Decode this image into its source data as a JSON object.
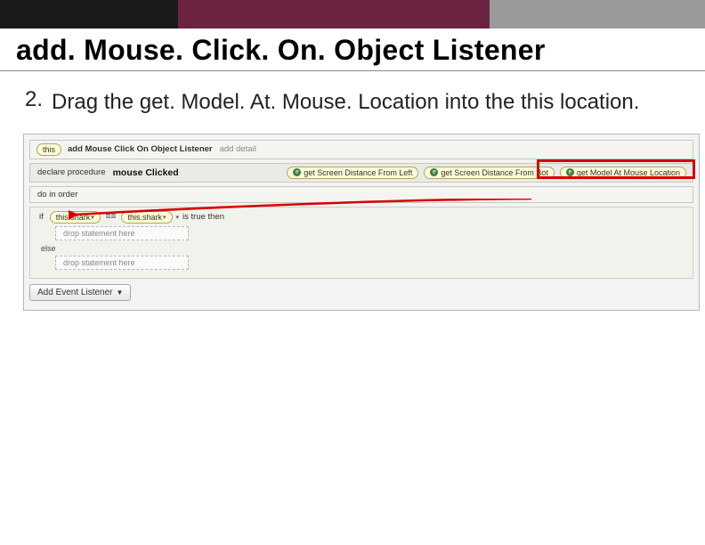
{
  "title": "add. Mouse. Click. On. Object Listener",
  "step": {
    "num": "2.",
    "text": "Drag the get. Model. At. Mouse. Location into the this location."
  },
  "panel": {
    "this": "this",
    "listener": "add Mouse Click On Object Listener",
    "addDetail": "add detail",
    "declare": "declare procedure",
    "proc": "mouse Clicked",
    "chipE": "e",
    "chipLeft": "get Screen Distance From Left",
    "chipBot": "get Screen Distance From Bot",
    "chipModel": "get Model At Mouse Location",
    "doInOrder": "do in order",
    "if": "if",
    "shark1": "this.shark",
    "eq": "==",
    "shark2": "this.shark",
    "isTrue": "is true then",
    "dropStmt": "drop statement here",
    "else": "else",
    "addEvent": "Add Event Listener"
  }
}
